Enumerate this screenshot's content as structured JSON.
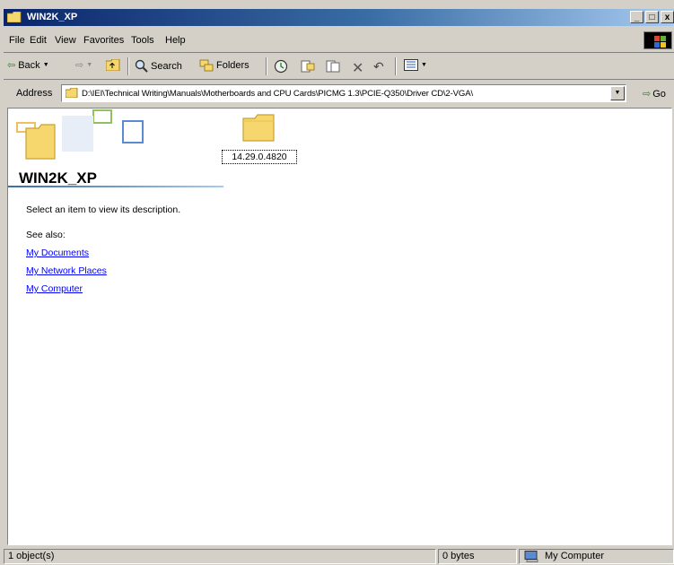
{
  "window": {
    "title": "WIN2K_XP"
  },
  "title_buttons": {
    "minimize": "_",
    "maximize": "□",
    "close": "x"
  },
  "menu": [
    "File",
    "Edit",
    "View",
    "Favorites",
    "Tools",
    "Help"
  ],
  "toolbar": {
    "back": "Back",
    "search": "Search",
    "folders": "Folders"
  },
  "address": {
    "label": "Address",
    "path": "D:\\IEI\\Technical Writing\\Manuals\\Motherboards and CPU Cards\\PICMG 1.3\\PCIE-Q350\\Driver CD\\2-VGA\\",
    "go": "Go"
  },
  "panel": {
    "folder_title": "WIN2K_XP",
    "description": "Select an item to view its description.",
    "see_also": "See also:",
    "links": [
      "My Documents",
      "My Network Places",
      "My Computer"
    ]
  },
  "items": [
    {
      "name": "14.29.0.4820",
      "type": "folder"
    }
  ],
  "status": {
    "objects": "1 object(s)",
    "size": "0 bytes",
    "zone": "My Computer"
  },
  "colors": {
    "title_bar": "#0a246a",
    "chrome": "#d4d0c8",
    "link": "#0000ff",
    "folder": "#f5d76e"
  }
}
